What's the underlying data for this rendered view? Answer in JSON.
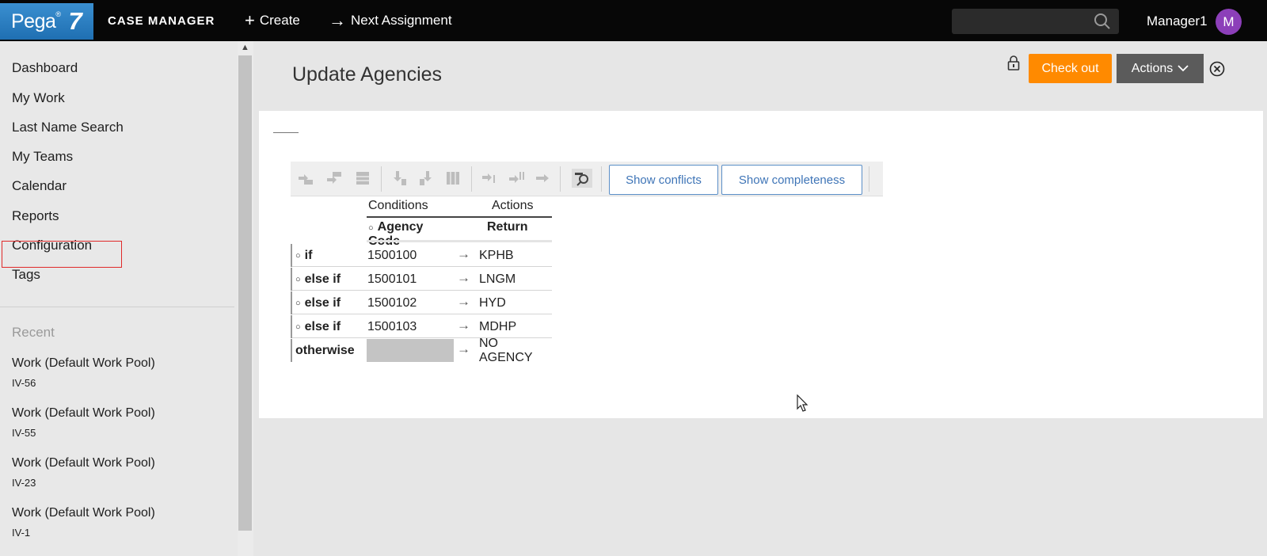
{
  "header": {
    "logo_word": "Pega",
    "logo_reg": "®",
    "logo_num": "7",
    "app_name": "CASE MANAGER",
    "create_label": "Create",
    "next_assignment_label": "Next Assignment",
    "user_name": "Manager1",
    "avatar_initial": "M"
  },
  "sidebar": {
    "items": [
      "Dashboard",
      "My Work",
      "Last Name Search",
      "My Teams",
      "Calendar",
      "Reports",
      "Configuration",
      "Tags"
    ],
    "recent_heading": "Recent",
    "recent": [
      {
        "title": "Work (Default Work Pool)",
        "id": "IV-56"
      },
      {
        "title": "Work (Default Work Pool)",
        "id": "IV-55"
      },
      {
        "title": "Work (Default Work Pool)",
        "id": "IV-23"
      },
      {
        "title": "Work (Default Work Pool)",
        "id": "IV-1"
      }
    ]
  },
  "main": {
    "title": "Update Agencies",
    "checkout_label": "Check out",
    "actions_label": "Actions"
  },
  "toolbar": {
    "show_conflicts": "Show conflicts",
    "show_completeness": "Show completeness"
  },
  "decision_table": {
    "conditions_group": "Conditions",
    "actions_group": "Actions",
    "condition_column": "Agency Code",
    "return_column": "Return",
    "rows": [
      {
        "label": "if",
        "condition": "1500100",
        "arrow": "→",
        "result": "KPHB"
      },
      {
        "label": "else if",
        "condition": "1500101",
        "arrow": "→",
        "result": "LNGM"
      },
      {
        "label": "else if",
        "condition": "1500102",
        "arrow": "→",
        "result": "HYD"
      },
      {
        "label": "else if",
        "condition": "1500103",
        "arrow": "→",
        "result": "MDHP"
      },
      {
        "label": "otherwise",
        "condition": "",
        "arrow": "→",
        "result": "NO AGENCY"
      }
    ]
  },
  "colors": {
    "topbar": "#070707",
    "brand_blue": "#1f6fb2",
    "checkout_orange": "#ff8a00",
    "actions_gray": "#5b5b5b",
    "avatar_purple": "#8c3fb9",
    "highlight_red": "#e02a2a",
    "link_blue": "#3f75b7"
  }
}
